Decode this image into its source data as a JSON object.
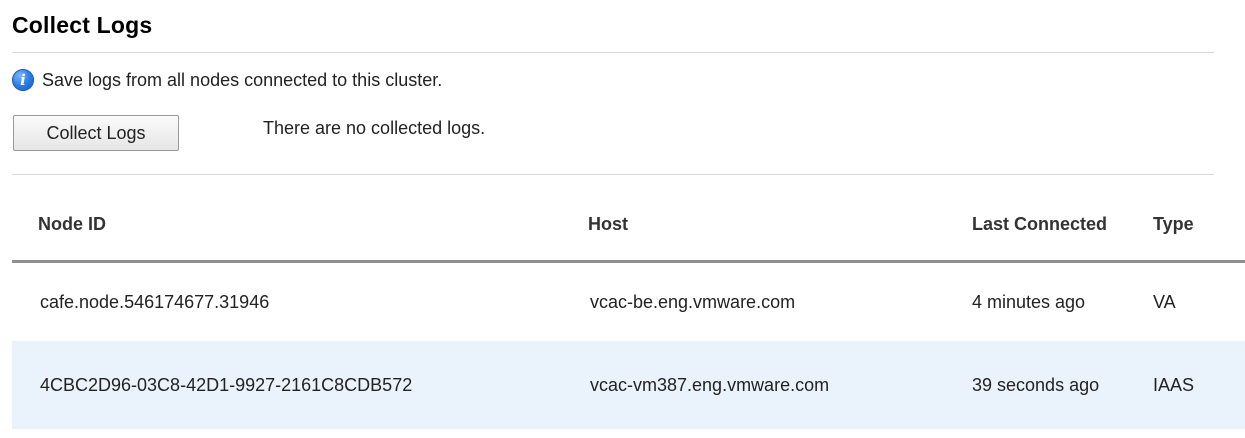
{
  "page": {
    "title": "Collect Logs",
    "info_text": "Save logs from all nodes connected to this cluster.",
    "info_icon": "info-icon",
    "collect_button_label": "Collect Logs",
    "status_text": "There are no collected logs."
  },
  "table": {
    "headers": {
      "node_id": "Node ID",
      "host": "Host",
      "last_connected": "Last Connected",
      "type": "Type"
    },
    "rows": [
      {
        "node_id": "cafe.node.546174677.31946",
        "host": "vcac-be.eng.vmware.com",
        "last_connected": "4 minutes ago",
        "type": "VA"
      },
      {
        "node_id": "4CBC2D96-03C8-42D1-9927-2161C8CDB572",
        "host": "vcac-vm387.eng.vmware.com",
        "last_connected": "39 seconds ago",
        "type": "IAAS"
      }
    ]
  },
  "colors": {
    "info_icon_blue": "#2f7fe6",
    "alt_row_background": "#eaf3fb",
    "header_rule": "#8f8f8f"
  }
}
